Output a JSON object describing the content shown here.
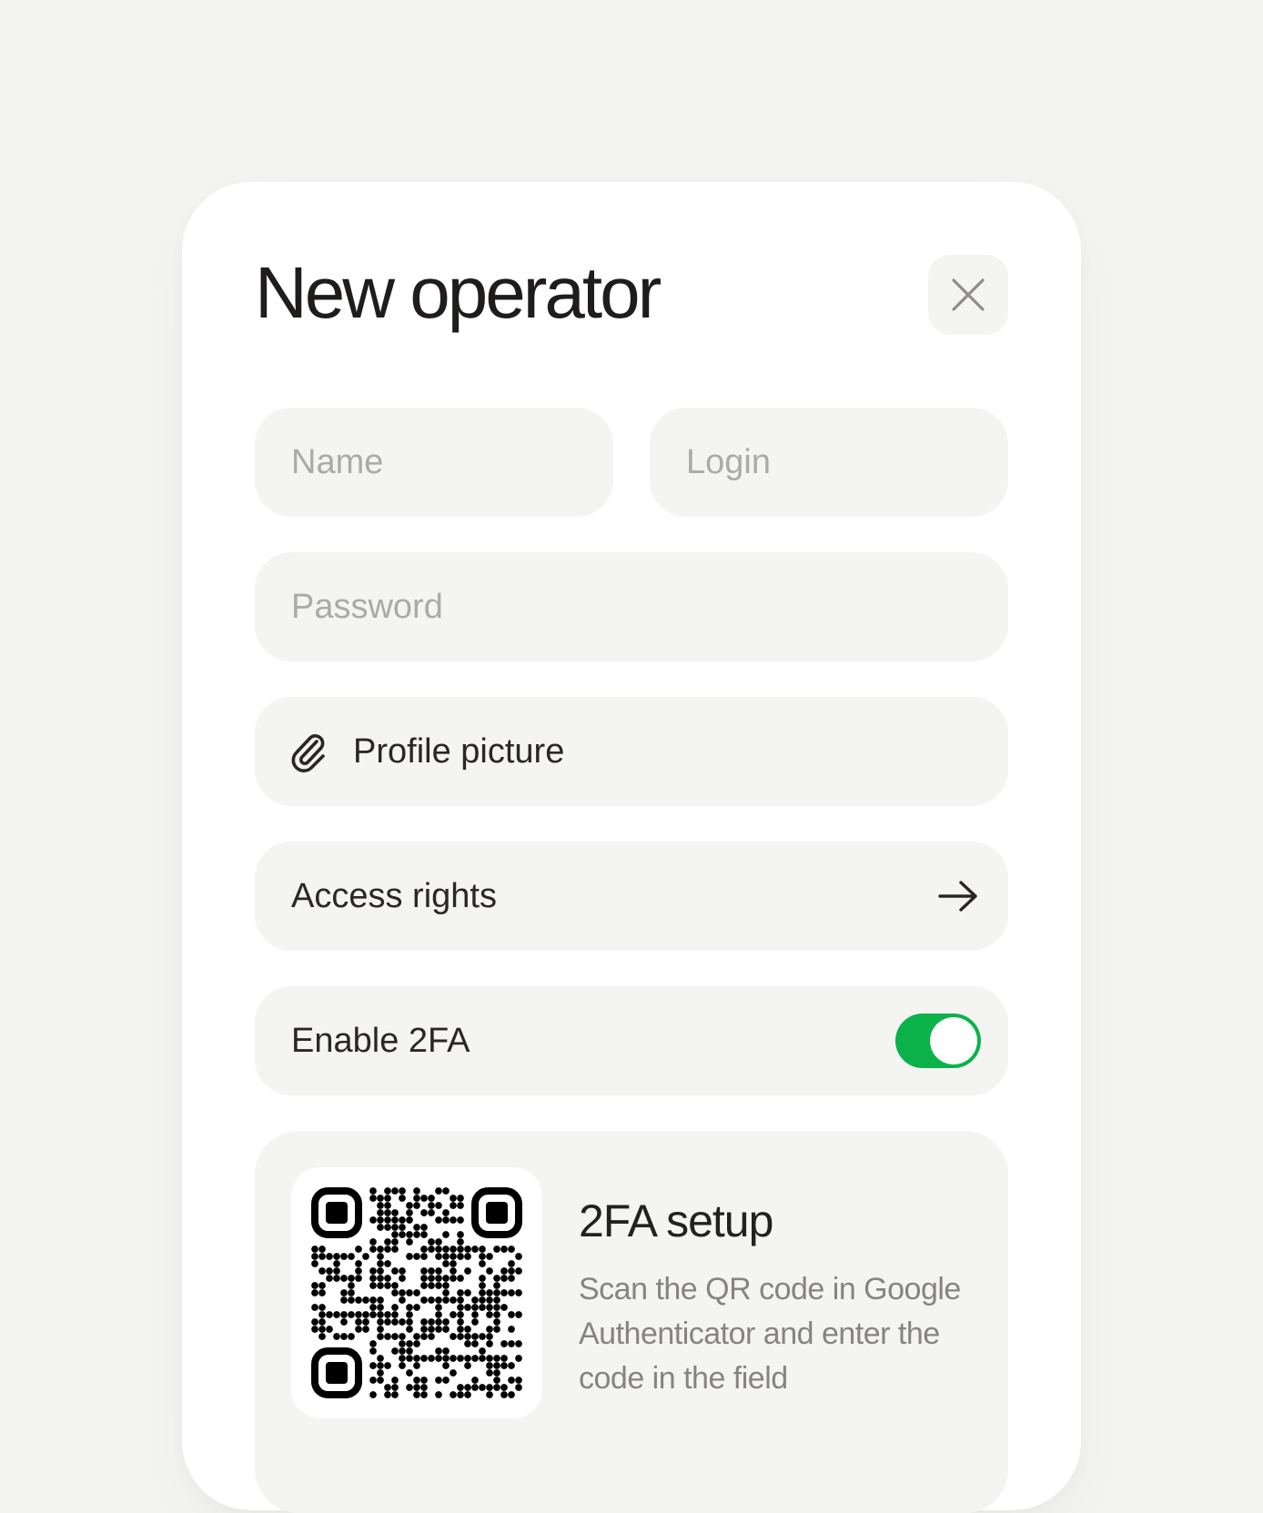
{
  "dialog": {
    "title": "New operator"
  },
  "fields": {
    "name_placeholder": "Name",
    "login_placeholder": "Login",
    "password_placeholder": "Password",
    "profile_picture_label": "Profile picture",
    "access_rights_label": "Access rights",
    "enable_2fa_label": "Enable 2FA",
    "enable_2fa_on": true
  },
  "setup_2fa": {
    "title": "2FA setup",
    "description": "Scan the QR code in Google Authenticator and enter the code in the field"
  },
  "icons": {
    "close": "close-icon",
    "attach": "paperclip-icon",
    "access": "arrow-right-icon",
    "qr": "qr-code"
  },
  "colors": {
    "background": "#f4f4f3",
    "card": "#ffffff",
    "field": "#f4f4f3",
    "toggle_on": "#0bb24a",
    "text": "#1f1c1c",
    "placeholder": "#acaaa8",
    "muted": "#868483"
  }
}
